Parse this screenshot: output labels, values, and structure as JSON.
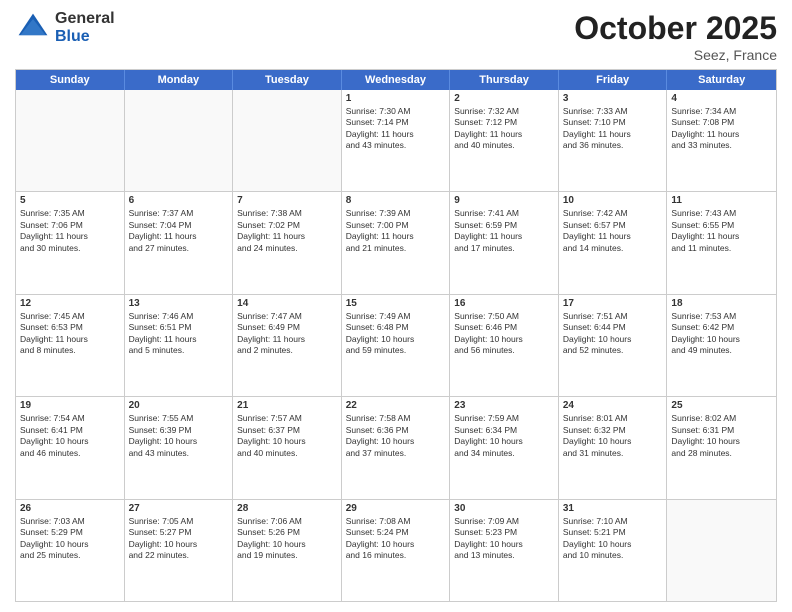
{
  "header": {
    "logo_general": "General",
    "logo_blue": "Blue",
    "month_title": "October 2025",
    "location": "Seez, France"
  },
  "weekdays": [
    "Sunday",
    "Monday",
    "Tuesday",
    "Wednesday",
    "Thursday",
    "Friday",
    "Saturday"
  ],
  "rows": [
    [
      {
        "day": "",
        "info": ""
      },
      {
        "day": "",
        "info": ""
      },
      {
        "day": "",
        "info": ""
      },
      {
        "day": "1",
        "info": "Sunrise: 7:30 AM\nSunset: 7:14 PM\nDaylight: 11 hours\nand 43 minutes."
      },
      {
        "day": "2",
        "info": "Sunrise: 7:32 AM\nSunset: 7:12 PM\nDaylight: 11 hours\nand 40 minutes."
      },
      {
        "day": "3",
        "info": "Sunrise: 7:33 AM\nSunset: 7:10 PM\nDaylight: 11 hours\nand 36 minutes."
      },
      {
        "day": "4",
        "info": "Sunrise: 7:34 AM\nSunset: 7:08 PM\nDaylight: 11 hours\nand 33 minutes."
      }
    ],
    [
      {
        "day": "5",
        "info": "Sunrise: 7:35 AM\nSunset: 7:06 PM\nDaylight: 11 hours\nand 30 minutes."
      },
      {
        "day": "6",
        "info": "Sunrise: 7:37 AM\nSunset: 7:04 PM\nDaylight: 11 hours\nand 27 minutes."
      },
      {
        "day": "7",
        "info": "Sunrise: 7:38 AM\nSunset: 7:02 PM\nDaylight: 11 hours\nand 24 minutes."
      },
      {
        "day": "8",
        "info": "Sunrise: 7:39 AM\nSunset: 7:00 PM\nDaylight: 11 hours\nand 21 minutes."
      },
      {
        "day": "9",
        "info": "Sunrise: 7:41 AM\nSunset: 6:59 PM\nDaylight: 11 hours\nand 17 minutes."
      },
      {
        "day": "10",
        "info": "Sunrise: 7:42 AM\nSunset: 6:57 PM\nDaylight: 11 hours\nand 14 minutes."
      },
      {
        "day": "11",
        "info": "Sunrise: 7:43 AM\nSunset: 6:55 PM\nDaylight: 11 hours\nand 11 minutes."
      }
    ],
    [
      {
        "day": "12",
        "info": "Sunrise: 7:45 AM\nSunset: 6:53 PM\nDaylight: 11 hours\nand 8 minutes."
      },
      {
        "day": "13",
        "info": "Sunrise: 7:46 AM\nSunset: 6:51 PM\nDaylight: 11 hours\nand 5 minutes."
      },
      {
        "day": "14",
        "info": "Sunrise: 7:47 AM\nSunset: 6:49 PM\nDaylight: 11 hours\nand 2 minutes."
      },
      {
        "day": "15",
        "info": "Sunrise: 7:49 AM\nSunset: 6:48 PM\nDaylight: 10 hours\nand 59 minutes."
      },
      {
        "day": "16",
        "info": "Sunrise: 7:50 AM\nSunset: 6:46 PM\nDaylight: 10 hours\nand 56 minutes."
      },
      {
        "day": "17",
        "info": "Sunrise: 7:51 AM\nSunset: 6:44 PM\nDaylight: 10 hours\nand 52 minutes."
      },
      {
        "day": "18",
        "info": "Sunrise: 7:53 AM\nSunset: 6:42 PM\nDaylight: 10 hours\nand 49 minutes."
      }
    ],
    [
      {
        "day": "19",
        "info": "Sunrise: 7:54 AM\nSunset: 6:41 PM\nDaylight: 10 hours\nand 46 minutes."
      },
      {
        "day": "20",
        "info": "Sunrise: 7:55 AM\nSunset: 6:39 PM\nDaylight: 10 hours\nand 43 minutes."
      },
      {
        "day": "21",
        "info": "Sunrise: 7:57 AM\nSunset: 6:37 PM\nDaylight: 10 hours\nand 40 minutes."
      },
      {
        "day": "22",
        "info": "Sunrise: 7:58 AM\nSunset: 6:36 PM\nDaylight: 10 hours\nand 37 minutes."
      },
      {
        "day": "23",
        "info": "Sunrise: 7:59 AM\nSunset: 6:34 PM\nDaylight: 10 hours\nand 34 minutes."
      },
      {
        "day": "24",
        "info": "Sunrise: 8:01 AM\nSunset: 6:32 PM\nDaylight: 10 hours\nand 31 minutes."
      },
      {
        "day": "25",
        "info": "Sunrise: 8:02 AM\nSunset: 6:31 PM\nDaylight: 10 hours\nand 28 minutes."
      }
    ],
    [
      {
        "day": "26",
        "info": "Sunrise: 7:03 AM\nSunset: 5:29 PM\nDaylight: 10 hours\nand 25 minutes."
      },
      {
        "day": "27",
        "info": "Sunrise: 7:05 AM\nSunset: 5:27 PM\nDaylight: 10 hours\nand 22 minutes."
      },
      {
        "day": "28",
        "info": "Sunrise: 7:06 AM\nSunset: 5:26 PM\nDaylight: 10 hours\nand 19 minutes."
      },
      {
        "day": "29",
        "info": "Sunrise: 7:08 AM\nSunset: 5:24 PM\nDaylight: 10 hours\nand 16 minutes."
      },
      {
        "day": "30",
        "info": "Sunrise: 7:09 AM\nSunset: 5:23 PM\nDaylight: 10 hours\nand 13 minutes."
      },
      {
        "day": "31",
        "info": "Sunrise: 7:10 AM\nSunset: 5:21 PM\nDaylight: 10 hours\nand 10 minutes."
      },
      {
        "day": "",
        "info": ""
      }
    ]
  ]
}
